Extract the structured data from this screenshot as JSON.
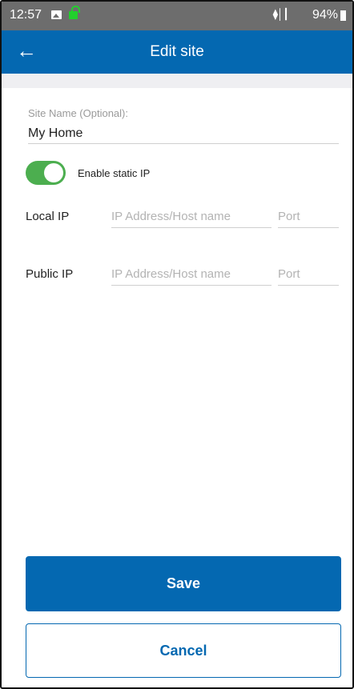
{
  "status_bar": {
    "time": "12:57",
    "icons": [
      "image-icon",
      "lock-icon",
      "wifi-icon",
      "signal-icon",
      "battery-icon"
    ],
    "battery": "94%"
  },
  "app_bar": {
    "title": "Edit site",
    "back_icon": "arrow-left-icon"
  },
  "site_name": {
    "label": "Site Name (Optional):",
    "value": "My Home"
  },
  "static_ip": {
    "label": "Enable static IP",
    "enabled": true
  },
  "local_ip": {
    "label": "Local IP",
    "address_placeholder": "IP Address/Host name",
    "port_placeholder": "Port"
  },
  "public_ip": {
    "label": "Public IP",
    "address_placeholder": "IP Address/Host name",
    "port_placeholder": "Port"
  },
  "buttons": {
    "save": "Save",
    "cancel": "Cancel"
  },
  "colors": {
    "primary": "#0468b1",
    "toggle_on": "#4cae4f",
    "status_bar": "#6d6d6d"
  }
}
